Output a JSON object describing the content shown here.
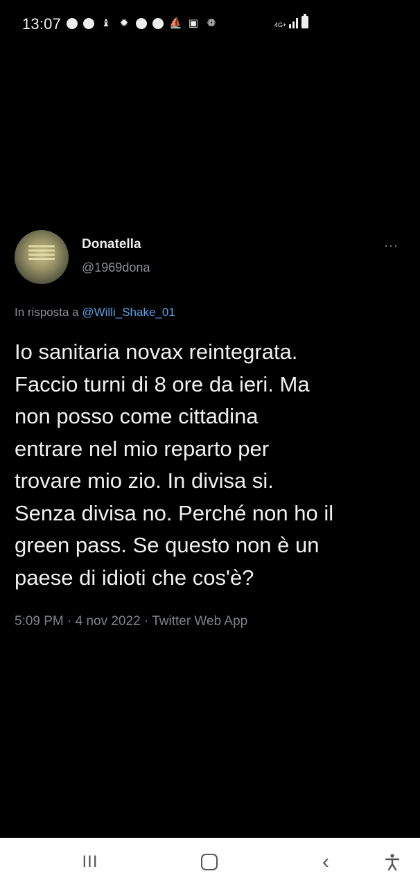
{
  "status_bar": {
    "time": "13:07",
    "notification_icons": [
      "circle-icon",
      "circle-icon",
      "bell-icon",
      "sun-icon",
      "chrome-icon",
      "circle-icon",
      "boat-icon",
      "image-icon",
      "paw-icon"
    ],
    "network": "4G+",
    "signal_bars": 3
  },
  "tweet": {
    "display_name": "Donatella",
    "handle": "@1969dona",
    "more_label": "···",
    "reply_prefix": "In risposta a",
    "reply_to": "@Willi_Shake_01",
    "text": "Io sanitaria novax reintegrata.\nFaccio turni di 8 ore da ieri. Ma\nnon posso come cittadina\nentrare nel mio reparto per\ntrovare mio zio. In divisa si.\nSenza divisa no. Perché non ho il\ngreen pass. Se questo non è un\npaese di idioti che cos'è?",
    "meta": "5:09 PM · 4 nov 2022 · Twitter Web App"
  },
  "nav_bar": {
    "recents_label": "III",
    "back_label": "‹"
  }
}
